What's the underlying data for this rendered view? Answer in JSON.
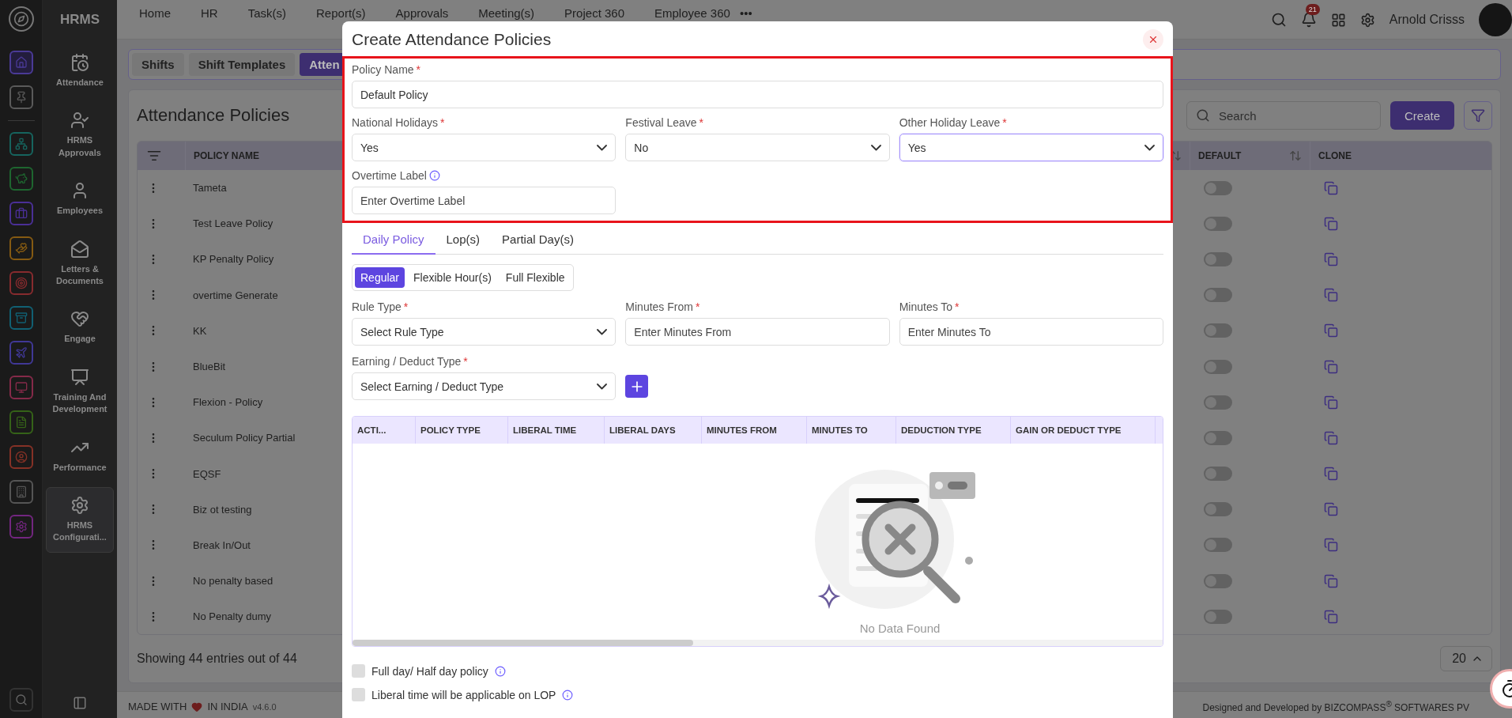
{
  "rail": [
    {
      "color": "#4a3a96",
      "selected": true
    },
    {
      "color": "#5a5a5a",
      "selected": false
    },
    {
      "color": "#16645e",
      "selected": false
    },
    {
      "color": "#1e662f",
      "selected": false
    },
    {
      "color": "#4a2f96",
      "selected": false
    },
    {
      "color": "#855a12",
      "selected": false
    },
    {
      "color": "#872b2e",
      "selected": false
    },
    {
      "color": "#116073",
      "selected": false
    },
    {
      "color": "#403896",
      "selected": false
    },
    {
      "color": "#852a49",
      "selected": false
    },
    {
      "color": "#356218",
      "selected": false
    },
    {
      "color": "#853126",
      "selected": false
    },
    {
      "color": "#555555",
      "selected": false
    },
    {
      "color": "#72267f",
      "selected": false
    }
  ],
  "app_name": "HRMS",
  "sidebar": {
    "items": [
      {
        "label": "Attendance",
        "selected": false
      },
      {
        "label": "HRMS Approvals",
        "selected": false
      },
      {
        "label": "Employees",
        "selected": false
      },
      {
        "label": "Letters & Documents",
        "selected": false
      },
      {
        "label": "Engage",
        "selected": false
      },
      {
        "label": "Training And Development",
        "selected": false
      },
      {
        "label": "Performance",
        "selected": false
      },
      {
        "label": "HRMS Configurati...",
        "selected": true
      }
    ]
  },
  "topbar": {
    "menu": [
      "Home",
      "HR",
      "Task(s)",
      "Report(s)",
      "Approvals",
      "Meeting(s)",
      "Project 360",
      "Employee 360"
    ],
    "more": "•••",
    "notifications": "21",
    "user": "Arnold Crisss"
  },
  "subtabs": [
    {
      "label": "Shifts",
      "selected": false
    },
    {
      "label": "Shift Templates",
      "selected": false
    },
    {
      "label": "Atten",
      "selected": true
    }
  ],
  "page": {
    "title": "Attendance Policies",
    "search": {
      "placeholder": "Search"
    },
    "create": "Create",
    "table": {
      "columns": [
        "POLICY NAME",
        "DEFAULT",
        "CLONE"
      ],
      "rows": [
        {
          "name": "Tameta",
          "default": false
        },
        {
          "name": "Test Leave Policy",
          "default": false
        },
        {
          "name": "KP Penalty Policy",
          "default": false
        },
        {
          "name": "overtime Generate",
          "default": false
        },
        {
          "name": "KK",
          "default": false
        },
        {
          "name": "BlueBit",
          "default": false
        },
        {
          "name": "Flexion - Policy",
          "default": false
        },
        {
          "name": "Seculum Policy Partial",
          "default": false
        },
        {
          "name": "EQSF",
          "default": false
        },
        {
          "name": "Biz ot testing",
          "default": false
        },
        {
          "name": "Break In/Out",
          "default": false
        },
        {
          "name": "No penalty based",
          "default": false
        },
        {
          "name": "No Penalty dumy",
          "default": false
        }
      ]
    },
    "summary": "Showing 44 entries out of 44",
    "page_size": "20"
  },
  "footer": {
    "made_with": "MADE WITH",
    "in_india": "IN INDIA",
    "version": "v4.6.0",
    "credit": "Designed and Developed by  BIZCOMPASS$^{®}$ SOFTWARES PV"
  },
  "modal": {
    "title": "Create Attendance Policies",
    "policy_name": {
      "label": "Policy Name",
      "asterisk": "*",
      "value": "Default Policy"
    },
    "selects": [
      {
        "label": "National Holidays",
        "asterisk": "*",
        "value": "Yes",
        "focused": false
      },
      {
        "label": "Festival Leave",
        "asterisk": "*",
        "value": "No",
        "focused": false
      },
      {
        "label": "Other Holiday Leave",
        "asterisk": "*",
        "value": "Yes",
        "focused": true
      }
    ],
    "overtime": {
      "label": "Overtime Label",
      "info": true,
      "placeholder": "Enter Overtime Label"
    },
    "tabs": [
      {
        "label": "Daily Policy",
        "selected": true
      },
      {
        "label": "Lop(s)",
        "selected": false
      },
      {
        "label": "Partial Day(s)",
        "selected": false
      }
    ],
    "modes": [
      {
        "label": "Regular",
        "selected": true
      },
      {
        "label": "Flexible Hour(s)",
        "selected": false
      },
      {
        "label": "Full Flexible",
        "selected": false
      }
    ],
    "rule_fields": [
      {
        "kind": "select",
        "label": "Rule Type",
        "asterisk": "*",
        "placeholder": "Select Rule Type"
      },
      {
        "kind": "input",
        "label": "Minutes From",
        "asterisk": "*",
        "placeholder": "Enter Minutes From"
      },
      {
        "kind": "input",
        "label": "Minutes To",
        "asterisk": "*",
        "placeholder": "Enter Minutes To"
      }
    ],
    "earning": {
      "label": "Earning / Deduct Type",
      "asterisk": "*",
      "placeholder": "Select Earning / Deduct Type"
    },
    "table": {
      "columns": [
        "ACTI...",
        "POLICY TYPE",
        "LIBERAL TIME",
        "LIBERAL DAYS",
        "MINUTES FROM",
        "MINUTES TO",
        "DEDUCTION TYPE",
        "GAIN OR DEDUCT TYPE"
      ],
      "empty": "No Data Found"
    },
    "options": [
      {
        "label": "Full day/ Half day policy",
        "checked": false,
        "info": true
      },
      {
        "label": "Liberal time will be applicable on LOP",
        "checked": false,
        "info": true
      }
    ]
  }
}
